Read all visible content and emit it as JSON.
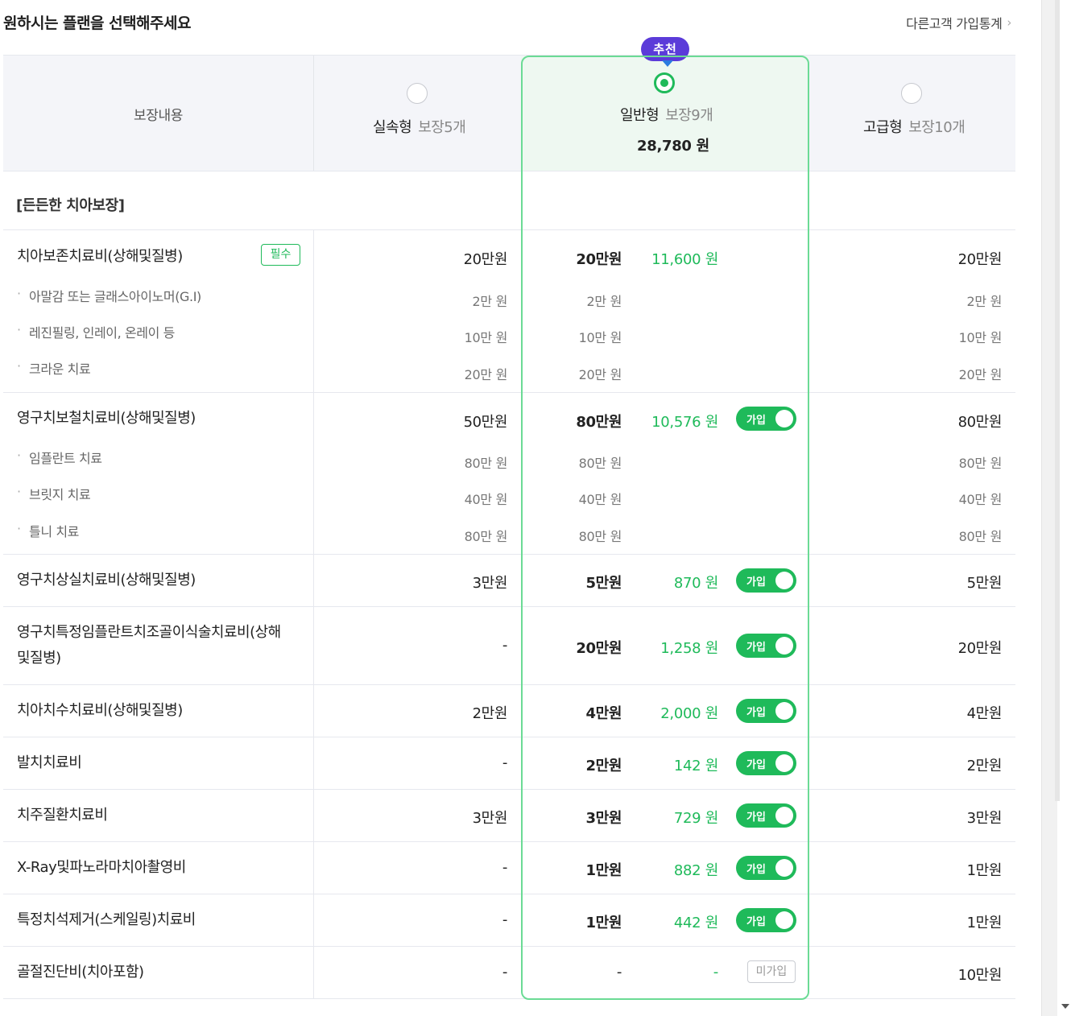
{
  "page": {
    "title": "원하시는 플랜을 선택해주세요",
    "stats_link": "다른고객 가입통계",
    "stats_chevron": "›"
  },
  "header": {
    "coverage_label": "보장내용",
    "recommend_badge": "추천",
    "plans": [
      {
        "name": "실속형",
        "count": "보장5개",
        "price": "",
        "selected": false
      },
      {
        "name": "일반형",
        "count": "보장9개",
        "price": "28,780 원",
        "selected": true
      },
      {
        "name": "고급형",
        "count": "보장10개",
        "price": "",
        "selected": false
      }
    ]
  },
  "section": {
    "title": "[든든한 치아보장]"
  },
  "required_badge": "필수",
  "toggle_label": "가입",
  "not_joined_label": "미가입",
  "rows": [
    {
      "name": "치아보존치료비(상해및질병)",
      "required": true,
      "basic": "20만원",
      "standard": "20만원",
      "premium": "11,600 원",
      "toggle": false,
      "advanced": "20만원",
      "subs": [
        {
          "name": "아말감 또는 글래스아이노머(G.I)",
          "basic": "2만 원",
          "standard": "2만 원",
          "advanced": "2만 원"
        },
        {
          "name": "레진필링, 인레이, 온레이 등",
          "basic": "10만 원",
          "standard": "10만 원",
          "advanced": "10만 원"
        },
        {
          "name": "크라운 치료",
          "basic": "20만 원",
          "standard": "20만 원",
          "advanced": "20만 원"
        }
      ]
    },
    {
      "name": "영구치보철치료비(상해및질병)",
      "basic": "50만원",
      "standard": "80만원",
      "premium": "10,576 원",
      "toggle": true,
      "advanced": "80만원",
      "subs": [
        {
          "name": "임플란트 치료",
          "basic": "80만 원",
          "standard": "80만 원",
          "advanced": "80만 원"
        },
        {
          "name": "브릿지 치료",
          "basic": "40만 원",
          "standard": "40만 원",
          "advanced": "40만 원"
        },
        {
          "name": "틀니 치료",
          "basic": "80만 원",
          "standard": "80만 원",
          "advanced": "80만 원"
        }
      ]
    },
    {
      "name": "영구치상실치료비(상해및질병)",
      "basic": "3만원",
      "standard": "5만원",
      "premium": "870 원",
      "toggle": true,
      "advanced": "5만원"
    },
    {
      "name_line1": "영구치특정임플란트치조골이식술치료비(상해",
      "name_line2": "및질병)",
      "basic": "-",
      "standard": "20만원",
      "premium": "1,258 원",
      "toggle": true,
      "advanced": "20만원"
    },
    {
      "name": "치아치수치료비(상해및질병)",
      "basic": "2만원",
      "standard": "4만원",
      "premium": "2,000 원",
      "toggle": true,
      "advanced": "4만원"
    },
    {
      "name": "발치치료비",
      "basic": "-",
      "standard": "2만원",
      "premium": "142 원",
      "toggle": true,
      "advanced": "2만원"
    },
    {
      "name": "치주질환치료비",
      "basic": "3만원",
      "standard": "3만원",
      "premium": "729 원",
      "toggle": true,
      "advanced": "3만원"
    },
    {
      "name": "X-Ray및파노라마치아촬영비",
      "basic": "-",
      "standard": "1만원",
      "premium": "882 원",
      "toggle": true,
      "advanced": "1만원"
    },
    {
      "name": "특정치석제거(스케일링)치료비",
      "basic": "-",
      "standard": "1만원",
      "premium": "442 원",
      "toggle": true,
      "advanced": "1만원"
    },
    {
      "name": "골절진단비(치아포함)",
      "basic": "-",
      "standard": "-",
      "premium": "-",
      "toggle": false,
      "not_joined": true,
      "advanced": "10만원"
    }
  ],
  "colors": {
    "accent_green": "#1fba5a",
    "badge_purple": "#5b3bd9",
    "header_bg": "#f4f5f9",
    "highlight_bg": "#eef8f1"
  }
}
